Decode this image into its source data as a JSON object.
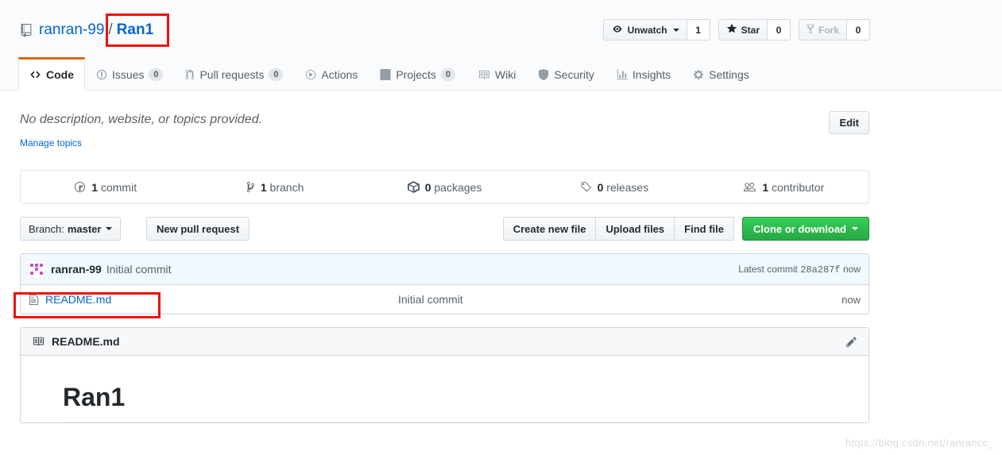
{
  "repo": {
    "owner": "ranran-99",
    "separator": "/",
    "name": "Ran1",
    "icon": "repo-book-icon"
  },
  "header_actions": {
    "watch": {
      "label": "Unwatch",
      "count": "1",
      "icon": "eye-icon"
    },
    "star": {
      "label": "Star",
      "count": "0",
      "icon": "star-icon"
    },
    "fork": {
      "label": "Fork",
      "count": "0",
      "icon": "fork-icon",
      "disabled": true
    }
  },
  "nav": {
    "tabs": [
      {
        "label": "Code",
        "icon": "code-icon",
        "count": null,
        "active": true
      },
      {
        "label": "Issues",
        "icon": "issue-opened-icon",
        "count": "0",
        "active": false
      },
      {
        "label": "Pull requests",
        "icon": "git-pull-request-icon",
        "count": "0",
        "active": false
      },
      {
        "label": "Actions",
        "icon": "play-icon",
        "count": null,
        "active": false
      },
      {
        "label": "Projects",
        "icon": "project-board-icon",
        "count": "0",
        "active": false
      },
      {
        "label": "Wiki",
        "icon": "book-icon",
        "count": null,
        "active": false
      },
      {
        "label": "Security",
        "icon": "shield-icon",
        "count": null,
        "active": false
      },
      {
        "label": "Insights",
        "icon": "graph-icon",
        "count": null,
        "active": false
      },
      {
        "label": "Settings",
        "icon": "gear-icon",
        "count": null,
        "active": false
      }
    ]
  },
  "description": {
    "text": "No description, website, or topics provided.",
    "manage_topics_label": "Manage topics",
    "edit_label": "Edit"
  },
  "numbers": [
    {
      "count": "1",
      "label": "commit",
      "icon": "history-icon"
    },
    {
      "count": "1",
      "label": "branch",
      "icon": "git-branch-icon"
    },
    {
      "count": "0",
      "label": "packages",
      "icon": "package-icon"
    },
    {
      "count": "0",
      "label": "releases",
      "icon": "tag-icon"
    },
    {
      "count": "1",
      "label": "contributor",
      "icon": "people-icon"
    }
  ],
  "toolbar": {
    "branch_label": "Branch:",
    "branch_value": "master",
    "new_pull_request": "New pull request",
    "create_new_file": "Create new file",
    "upload_files": "Upload files",
    "find_file": "Find file",
    "clone_or_download": "Clone or download"
  },
  "commit_bar": {
    "author": "ranran-99",
    "message": "Initial commit",
    "latest_prefix": "Latest commit",
    "sha": "28a287f",
    "age": "now"
  },
  "files": [
    {
      "name": "README.md",
      "icon": "file-icon",
      "message": "Initial commit",
      "age": "now"
    }
  ],
  "readme": {
    "title": "README.md",
    "icon": "book-icon",
    "edit_icon": "pencil-icon",
    "heading": "Ran1"
  },
  "watermark": "https://blog.csdn.net/ranrancc_",
  "colors": {
    "accent_blue": "#0366d6",
    "active_tab_border": "#e36209",
    "clone_green": "#28a745",
    "annotation_red": "#ee1111",
    "commit_bar_bg": "#f1f8ff"
  }
}
